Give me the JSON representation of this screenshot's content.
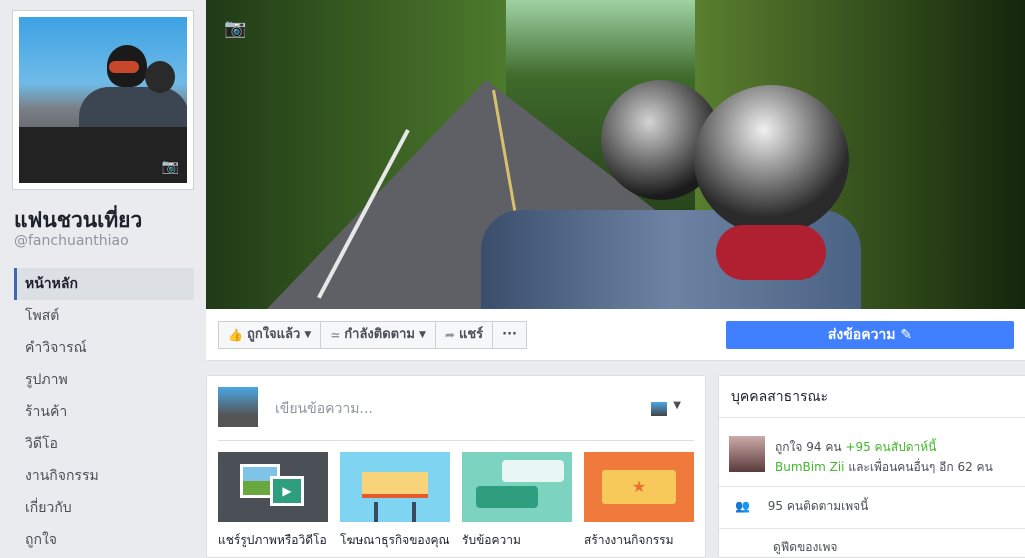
{
  "page": {
    "name": "แฟนชวนเที่ยว",
    "handle": "@fanchuanthiao"
  },
  "nav": [
    "หน้าหลัก",
    "โพสต์",
    "คำวิจารณ์",
    "รูปภาพ",
    "ร้านค้า",
    "วิดีโอ",
    "งานกิจกรรม",
    "เกี่ยวกับ",
    "ถูกใจ"
  ],
  "actions": {
    "liked_label": "ถูกใจแล้ว",
    "following_label": "กำลังติดตาม",
    "share_label": "แชร์",
    "more_label": "···",
    "send_message_label": "ส่งข้อความ"
  },
  "composer": {
    "placeholder": "เขียนข้อความ...",
    "tiles": [
      {
        "label": "แชร์รูปภาพหรือวิดีโอ"
      },
      {
        "label": "โฆษณาธุรกิจของคุณ"
      },
      {
        "label": "รับข้อความ"
      },
      {
        "label": "สร้างงานกิจกรรม"
      }
    ]
  },
  "info": {
    "category": "บุคคลสาธารณะ",
    "likes_prefix": "ถูกใจ 94 คน",
    "likes_week": "+95 คนสัปดาห์นี้",
    "friend_name": "BumBim Zii",
    "friend_suffix": "และเพื่อนคนอื่นๆ อีก 62 คน",
    "followers": "95 คนติดตามเพจนี้",
    "feed_label": "ดูฟีดของเพจ"
  },
  "colors": {
    "brand": "#4267b2",
    "send_button": "#4080ff",
    "like_green": "#42b72a"
  }
}
